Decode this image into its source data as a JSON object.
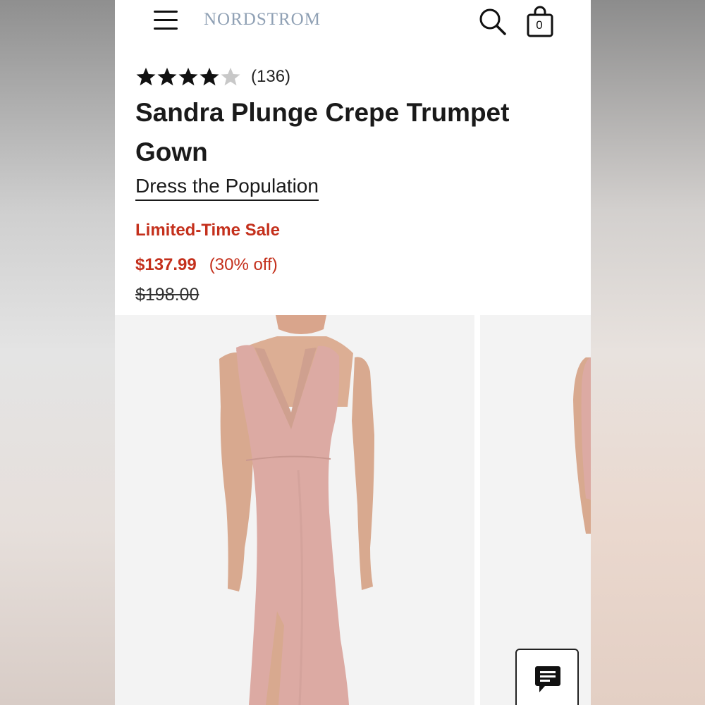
{
  "header": {
    "brand_logo": "NORDSTROM",
    "menu_icon": "hamburger-menu-icon",
    "search_icon": "search-icon",
    "bag_icon": "shopping-bag-icon",
    "bag_count": "0"
  },
  "product": {
    "rating": 4,
    "rating_max": 5,
    "review_count": "(136)",
    "title": "Sandra Plunge Crepe Trumpet Gown",
    "brand": "Dress the Population",
    "sale_label": "Limited-Time Sale",
    "sale_price": "$137.99",
    "discount": "(30% off)",
    "original_price": "$198.00"
  },
  "gallery": {
    "images": [
      "pink-gown-front-photo",
      "pink-gown-side-photo"
    ]
  },
  "chat": {
    "icon": "chat-icon"
  },
  "colors": {
    "sale_red": "#c4301c",
    "logo_blue_gray": "#8fa0b4",
    "dress_pink": "#d9aaa2",
    "text_dark": "#1a1a1a"
  }
}
